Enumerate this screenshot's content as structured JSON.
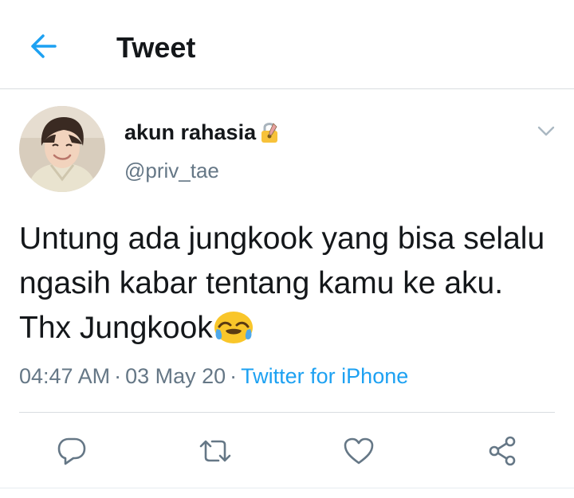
{
  "header": {
    "title": "Tweet",
    "back_icon": "arrow-left-icon",
    "accent": "#1da1f2"
  },
  "author": {
    "display_name": "akun rahasia",
    "lock_emoji": "🔏",
    "handle": "@priv_tae",
    "avatar": "profile-photo"
  },
  "tweet": {
    "text": "Untung ada jungkook yang bisa selalu ngasih kabar tentang kamu ke aku. Thx Jungkook",
    "emoji": "😭",
    "time": "04:47 AM",
    "separator": "·",
    "date": "03 May 20",
    "source": "Twitter for iPhone"
  },
  "actions": {
    "reply_icon": "reply-icon",
    "retweet_icon": "retweet-icon",
    "like_icon": "heart-icon",
    "share_icon": "share-icon"
  },
  "colors": {
    "text_primary": "#14171a",
    "text_secondary": "#657786",
    "link": "#1da1f2",
    "divider": "#d9dde0"
  }
}
